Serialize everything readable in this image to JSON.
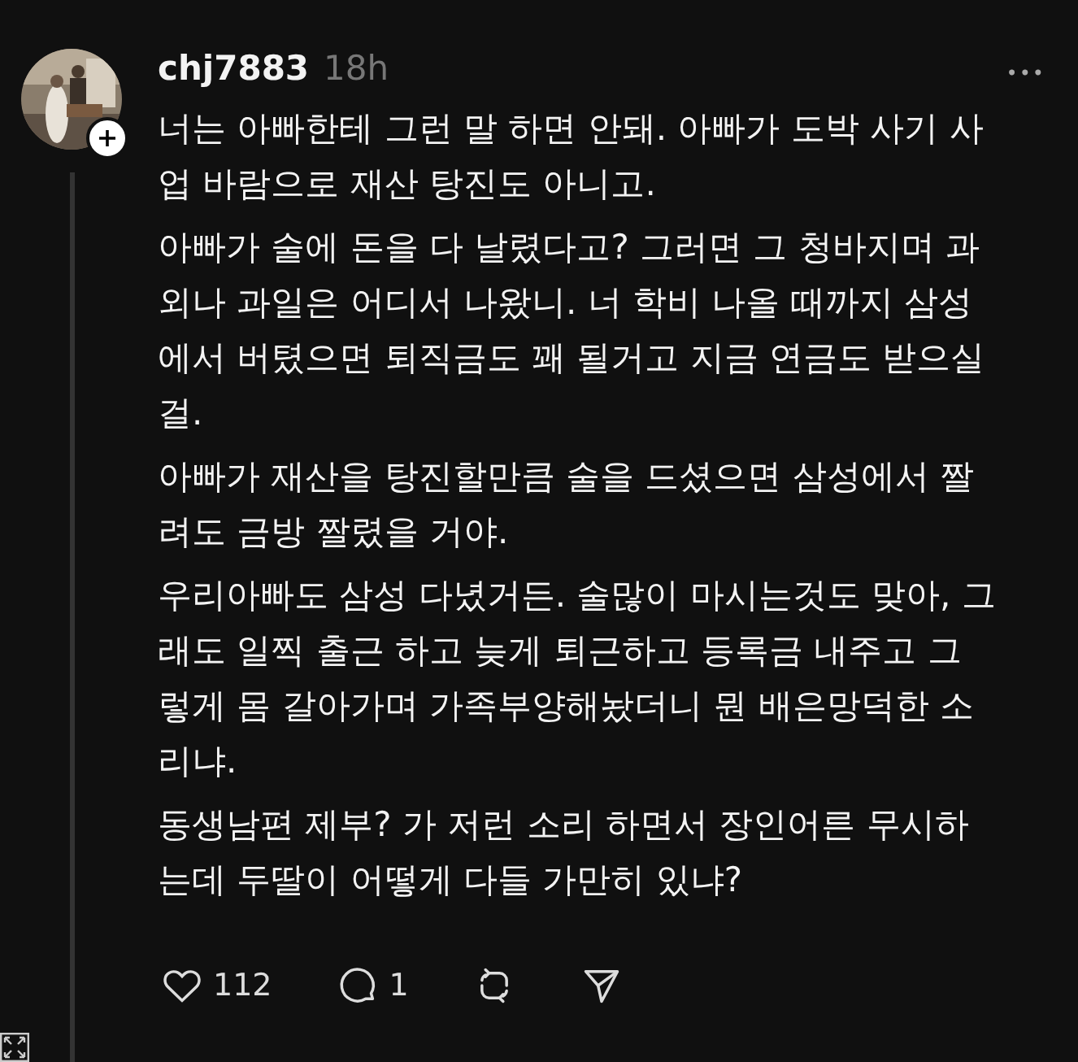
{
  "post": {
    "username": "chj7883",
    "time": "18h",
    "more": "•••",
    "paragraphs": [
      {
        "lines": [
          "너는 아빠한테 그런 말 하면 안돼. 아빠가 도박 사기 사",
          "업 바람으로 재산 탕진도 아니고."
        ]
      },
      {
        "lines": [
          "아빠가 술에 돈을 다 날렸다고? 그러면 그 청바지며 과",
          "외나 과일은 어디서 나왔니. 너 학비 나올 때까지 삼성",
          "에서 버텼으면  퇴직금도 꽤 될거고 지금 연금도 받으실",
          "걸."
        ]
      },
      {
        "lines": [
          "아빠가 재산을 탕진할만큼 술을 드셨으면 삼성에서 짤",
          "려도 금방 짤렸을 거야."
        ]
      },
      {
        "lines": [
          "우리아빠도 삼성 다녔거든. 술많이 마시는것도 맞아, 그",
          "래도  일찍 출근 하고 늦게 퇴근하고 등록금 내주고 그",
          "렇게 몸 갈아가며 가족부양해놨더니 뭔 배은망덕한 소",
          "리냐."
        ]
      },
      {
        "lines": [
          "동생남편 제부? 가 저런 소리 하면서 장인어른 무시하",
          "는데 두딸이 어떻게 다들 가만히 있냐?"
        ]
      }
    ],
    "actions": [
      {
        "kind": "like",
        "count": "112"
      },
      {
        "kind": "reply",
        "count": "1"
      },
      {
        "kind": "repost"
      },
      {
        "kind": "share"
      }
    ]
  }
}
